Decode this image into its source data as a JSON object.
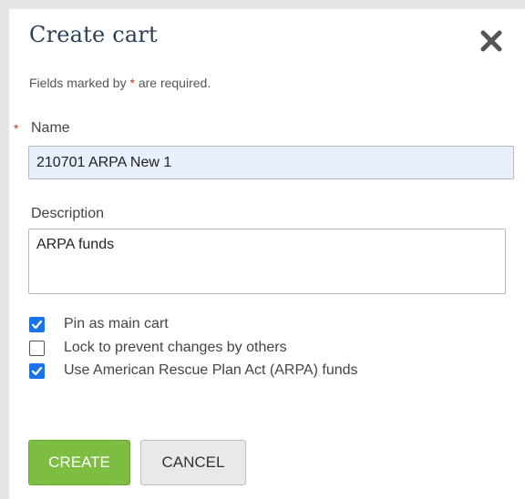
{
  "dialog": {
    "title": "Create cart",
    "close_icon": "close-x-icon"
  },
  "form": {
    "required_note_prefix": "Fields marked by ",
    "required_marker": "*",
    "required_note_suffix": " are required.",
    "name": {
      "label": "Name",
      "value": "210701 ARPA New 1"
    },
    "description": {
      "label": "Description",
      "value": "ARPA funds"
    },
    "options": [
      {
        "label": "Pin as main cart",
        "checked": true
      },
      {
        "label": "Lock to prevent changes by others",
        "checked": false
      },
      {
        "label": "Use American Rescue Plan Act (ARPA) funds",
        "checked": true
      }
    ]
  },
  "buttons": {
    "create": "CREATE",
    "cancel": "CANCEL"
  },
  "colors": {
    "create_button": "#7cbd42",
    "checkbox_checked": "#1a73e8",
    "name_field_autofill": "#e8f0fe",
    "required_marker": "#c0392b",
    "title_text": "#2b3f55"
  }
}
